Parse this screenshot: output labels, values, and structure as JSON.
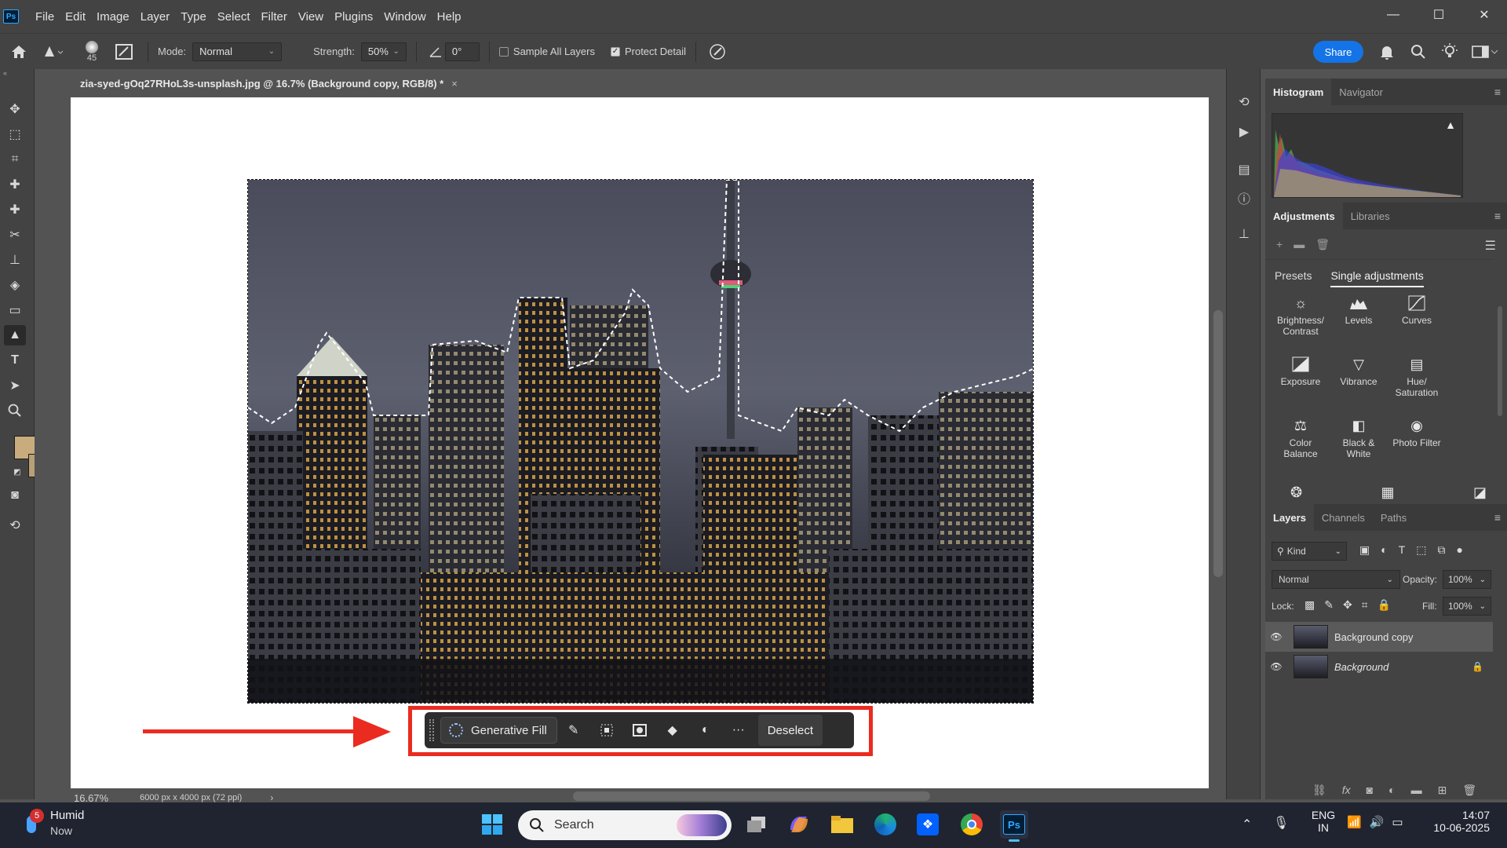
{
  "app": {
    "logo_text": "Ps",
    "menu": [
      "File",
      "Edit",
      "Image",
      "Layer",
      "Type",
      "Select",
      "Filter",
      "View",
      "Plugins",
      "Window",
      "Help"
    ],
    "window_controls": [
      "—",
      "☐",
      "✕"
    ]
  },
  "options_bar": {
    "brush_size": "45",
    "mode_label": "Mode:",
    "mode_value": "Normal",
    "strength_label": "Strength:",
    "strength_value": "50%",
    "angle_value": "0°",
    "sample_all_layers_label": "Sample All Layers",
    "sample_all_layers_checked": false,
    "protect_detail_label": "Protect Detail",
    "protect_detail_checked": true,
    "share_label": "Share"
  },
  "document": {
    "tab_title": "zia-syed-gOq27RHoL3s-unsplash.jpg @ 16.7% (Background copy, RGB/8) *",
    "tab_close": "×",
    "zoom": "16.67%",
    "doc_info": "6000 px x 4000 px (72 ppi)",
    "status_arrow": "›"
  },
  "context_bar": {
    "generative_fill_label": "Generative Fill",
    "deselect_label": "Deselect",
    "more_label": "···"
  },
  "histogram_panel": {
    "tabs": [
      "Histogram",
      "Navigator"
    ],
    "active_tab": "Histogram",
    "warning_icon": "▲"
  },
  "adjustments_panel": {
    "tabs": [
      "Adjustments",
      "Libraries"
    ],
    "subtabs": [
      "Presets",
      "Single adjustments"
    ],
    "items": [
      {
        "label": "Brightness/ Contrast",
        "icon": "sun-icon"
      },
      {
        "label": "Levels",
        "icon": "levels-icon"
      },
      {
        "label": "Curves",
        "icon": "curves-icon"
      },
      {
        "label": "Exposure",
        "icon": "exposure-icon"
      },
      {
        "label": "Vibrance",
        "icon": "vibrance-icon"
      },
      {
        "label": "Hue/ Saturation",
        "icon": "hue-saturation-icon"
      },
      {
        "label": "Color Balance",
        "icon": "color-balance-icon"
      },
      {
        "label": "Black & White",
        "icon": "black-white-icon"
      },
      {
        "label": "Photo Filter",
        "icon": "photo-filter-icon"
      }
    ]
  },
  "layers_panel": {
    "tabs": [
      "Layers",
      "Channels",
      "Paths"
    ],
    "kind_label": "Kind",
    "blend_mode": "Normal",
    "opacity_label": "Opacity:",
    "opacity_value": "100%",
    "lock_label": "Lock:",
    "fill_label": "Fill:",
    "fill_value": "100%",
    "layers": [
      {
        "name": "Background copy",
        "visible": true,
        "selected": true,
        "locked": false
      },
      {
        "name": "Background",
        "visible": true,
        "selected": false,
        "locked": true
      }
    ]
  },
  "taskbar": {
    "weather_badge": "5",
    "weather_title": "Humid",
    "weather_sub": "Now",
    "search_placeholder": "Search",
    "lang_top": "ENG",
    "lang_bottom": "IN",
    "time": "14:07",
    "date": "10-06-2025",
    "ps_label": "Ps"
  },
  "colors": {
    "foreground": "#c8ac7e",
    "background": "#b79f76",
    "accent_blue": "#1473e6",
    "highlight_red": "#ea2b1f"
  }
}
